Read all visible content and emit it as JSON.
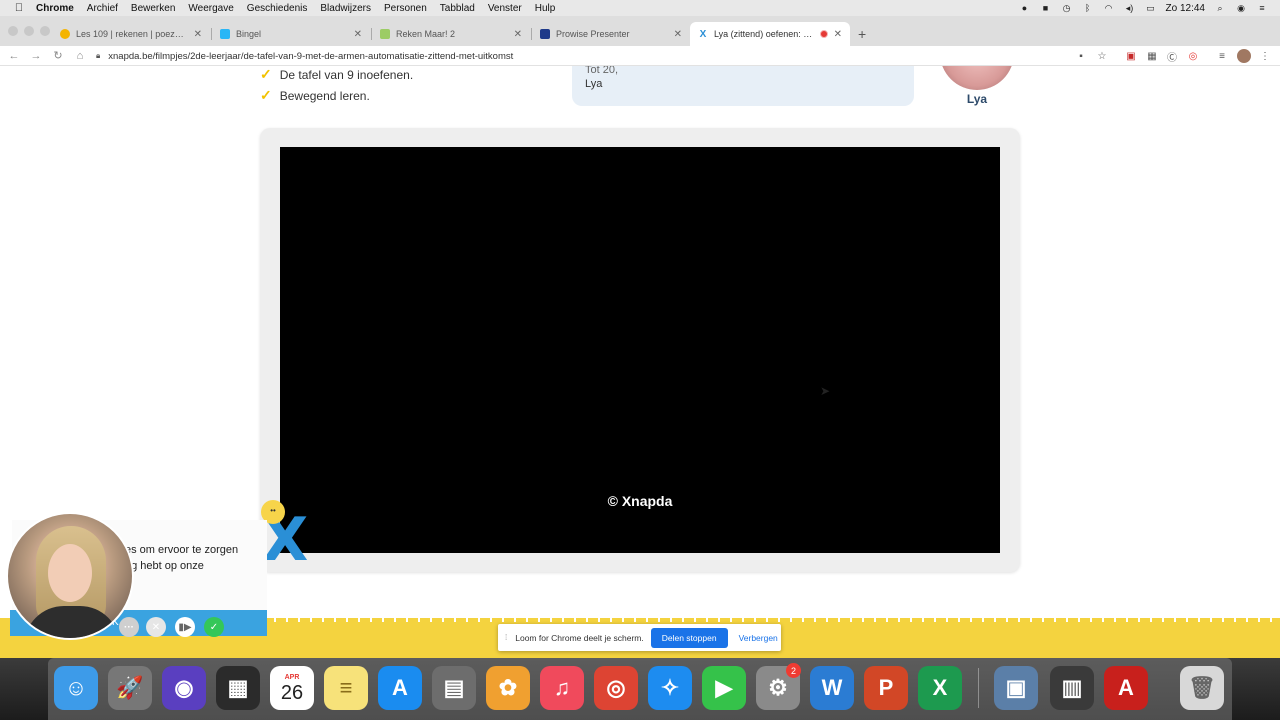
{
  "menubar": {
    "app": "Chrome",
    "items": [
      "Archief",
      "Bewerken",
      "Weergave",
      "Geschiedenis",
      "Bladwijzers",
      "Personen",
      "Tabblad",
      "Venster",
      "Hulp"
    ],
    "clock": "Zo 12:44"
  },
  "tabs": [
    {
      "title": "Les 109 | rekenen | poezenklas",
      "icon": "chrome-icon",
      "color": "#f4b400"
    },
    {
      "title": "Bingel",
      "icon": "bingel-icon",
      "color": "#29b6f6"
    },
    {
      "title": "Reken Maar! 2",
      "icon": "rekenmaar-icon",
      "color": "#9ccc65"
    },
    {
      "title": "Prowise Presenter",
      "icon": "prowise-icon",
      "color": "#1e3a8a"
    },
    {
      "title": "Lya (zittend) oefenen: De t",
      "icon": "xnapda-icon",
      "color": "#2a8fd6"
    }
  ],
  "toolbar": {
    "url": "xnapda.be/filmpjes/2de-leerjaar/de-tafel-van-9-met-de-armen-automatisatie-zittend-met-uitkomst"
  },
  "page": {
    "goals": [
      "De tafel van 9 inoefenen.",
      "Bewegend leren."
    ],
    "bubble_partial": "Tot 20,",
    "bubble_sign": "Lya",
    "avatar_name": "Lya",
    "watermark": "© Xnapda"
  },
  "loom": {
    "text_line1": "es om ervoor te zorgen",
    "text_line2": "ng hebt op onze",
    "bar_label": "K"
  },
  "share_bar": {
    "message": "Loom for Chrome deelt je scherm.",
    "stop_label": "Delen stoppen",
    "hide_label": "Verbergen"
  },
  "dock": {
    "calendar_month": "APR",
    "calendar_day": "26",
    "prefs_badge": "2",
    "apps": [
      {
        "name": "finder",
        "glyph": "☺",
        "color": "#3d9be9"
      },
      {
        "name": "launchpad",
        "glyph": "🚀",
        "color": "#777777"
      },
      {
        "name": "siri",
        "glyph": "◉",
        "color": "#5a3fc0"
      },
      {
        "name": "mission",
        "glyph": "▦",
        "color": "#2b2b2b"
      },
      {
        "name": "calendar",
        "glyph": "",
        "color": "#ffffff"
      },
      {
        "name": "notes",
        "glyph": "≡",
        "color": "#f7e27a"
      },
      {
        "name": "appstore",
        "glyph": "A",
        "color": "#1a8cf0"
      },
      {
        "name": "calculator",
        "glyph": "▤",
        "color": "#6d6d6d"
      },
      {
        "name": "photos",
        "glyph": "✿",
        "color": "#f0a030"
      },
      {
        "name": "music",
        "glyph": "♫",
        "color": "#f04a5c"
      },
      {
        "name": "chrome",
        "glyph": "◎",
        "color": "#dd4433"
      },
      {
        "name": "safari",
        "glyph": "✧",
        "color": "#1d8cf0"
      },
      {
        "name": "facetime",
        "glyph": "▶",
        "color": "#35c24a"
      },
      {
        "name": "prefs",
        "glyph": "⚙",
        "color": "#8a8a8a"
      },
      {
        "name": "word",
        "glyph": "W",
        "color": "#2b7cd3"
      },
      {
        "name": "powerpoint",
        "glyph": "P",
        "color": "#d24726"
      },
      {
        "name": "excel",
        "glyph": "X",
        "color": "#1d9a4f"
      },
      {
        "name": "preview",
        "glyph": "▣",
        "color": "#5b7fa8"
      },
      {
        "name": "photobooth",
        "glyph": "▥",
        "color": "#3a3a3a"
      },
      {
        "name": "acrobat",
        "glyph": "A",
        "color": "#c8201c"
      },
      {
        "name": "trash",
        "glyph": "🗑",
        "color": "#d8d8d8"
      }
    ]
  }
}
